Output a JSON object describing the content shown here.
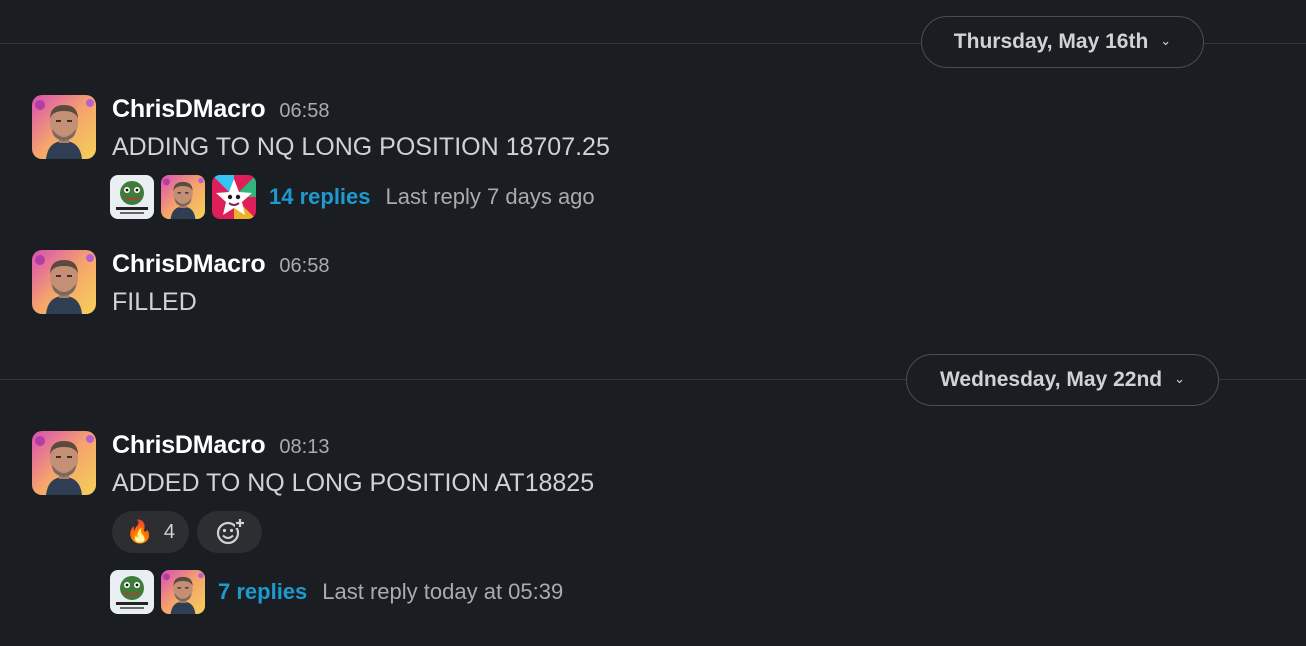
{
  "day_dividers": [
    {
      "label": "Thursday, May 16th",
      "chevron": "chevron-down-icon"
    },
    {
      "label": "Wednesday, May 22nd",
      "chevron": "chevron-down-icon"
    }
  ],
  "messages": [
    {
      "author": "ChrisDMacro",
      "time": "06:58",
      "text": "ADDING TO NQ LONG POSITION 18707.25",
      "thread": {
        "replies": "14 replies",
        "last_reply": "Last reply 7 days ago",
        "participants": [
          "frog-logo-avatar",
          "user-avatar",
          "star-face-avatar"
        ]
      }
    },
    {
      "author": "ChrisDMacro",
      "time": "06:58",
      "text": "FILLED"
    },
    {
      "author": "ChrisDMacro",
      "time": "08:13",
      "text": "ADDED TO NQ LONG POSITION AT18825",
      "reactions": [
        {
          "emoji": "🔥",
          "count": "4"
        }
      ],
      "add_reaction_icon": "add-reaction-icon",
      "thread": {
        "replies": "7 replies",
        "last_reply": "Last reply today at 05:39",
        "participants": [
          "frog-logo-avatar",
          "user-avatar"
        ]
      }
    }
  ],
  "colors": {
    "background": "#1a1d21",
    "link": "#1d9bd1",
    "muted": "#ababad",
    "author": "#ffffff"
  }
}
